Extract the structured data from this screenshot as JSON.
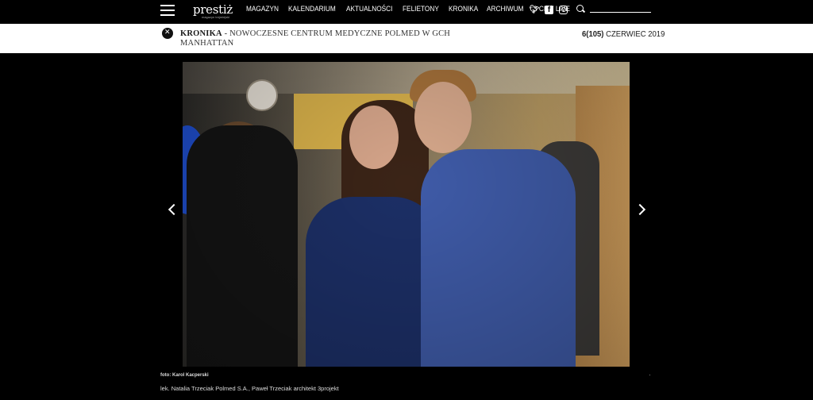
{
  "header": {
    "logo": "prestiż",
    "logo_tagline": "magazyn trójmiejski",
    "menu": [
      "MAGAZYN",
      "KALENDARIUM",
      "AKTUALNOŚCI",
      "FELIETONY",
      "KRONIKA",
      "ARCHIWUM",
      "3 CITY LIVE"
    ],
    "social_icons": [
      "twitter-icon",
      "facebook-icon",
      "instagram-icon"
    ],
    "search_value": ""
  },
  "breadcrumb": {
    "section": "KRONIKA",
    "separator": " - ",
    "title": "NOWOCZESNE CENTRUM MEDYCZNE POLMED W GCH MANHATTAN",
    "issue_number": "6(105)",
    "issue_date": "CZERWIEC 2019"
  },
  "gallery": {
    "photo_alt": "photo",
    "credit": "foto: Karol Kacperski",
    "caption": "lek. Natalia Trzeciak Polmed S.A., Paweł Trzeciak architekt 3projekt"
  }
}
